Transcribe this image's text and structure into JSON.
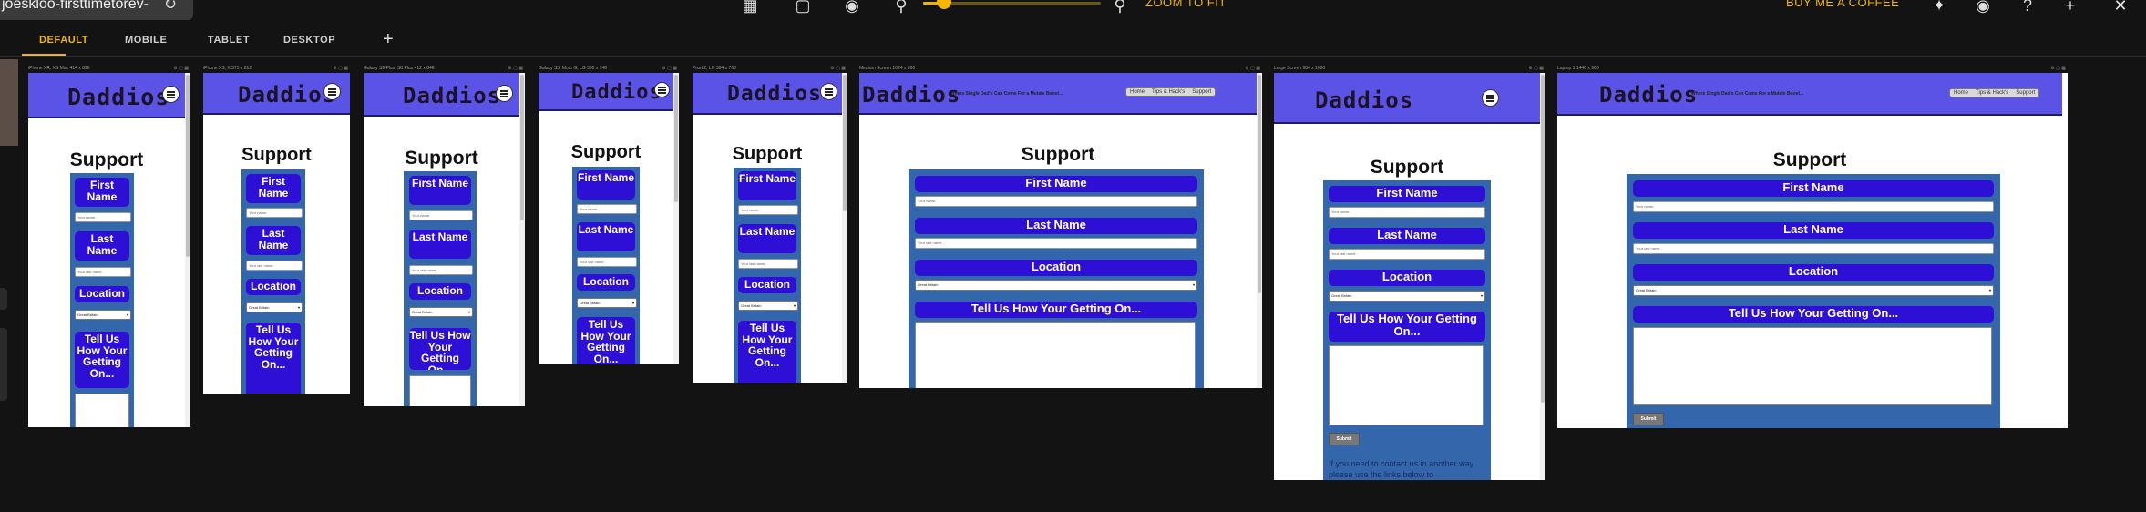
{
  "toolbar": {
    "url_text": "joeskloo-firsttimetorev-",
    "zoom_fit_label": "ZOOM TO FIT",
    "zoom_level_fraction": 0.12,
    "buy_coffee_label": "BUY ME A COFFEE",
    "icons": [
      "reload-icon",
      "grid-icon",
      "rotate-icon",
      "camera-icon",
      "zoom-out-icon",
      "zoom-in-icon",
      "twitter-icon",
      "github-icon",
      "help-icon",
      "plus-icon",
      "close-icon"
    ]
  },
  "tabs": [
    {
      "label": "DEFAULT",
      "active": true
    },
    {
      "label": "MOBILE",
      "active": false
    },
    {
      "label": "TABLET",
      "active": false
    },
    {
      "label": "DESKTOP",
      "active": false
    }
  ],
  "add_tab_label": "+",
  "site": {
    "logo": "Daddios",
    "tagline": "Where Single Dad's Can Come For a Mutale Boost...",
    "nav": [
      "Home",
      "Tips & Hack's",
      "Support"
    ],
    "page_title": "Support",
    "first_name_label": "First Name",
    "first_name_placeholder": "Your name..",
    "last_name_label": "Last Name",
    "last_name_placeholder": "Your last name..",
    "location_label": "Location",
    "location_value": "Great Britain",
    "message_label": "Tell Us How Your Getting On...",
    "submit_label": "Submit",
    "contact_note": "If you need to contact us in another way please use the links below to"
  },
  "devices": [
    {
      "name": "iPhone XR, XS Max",
      "size": "414 x 896"
    },
    {
      "name": "iPhone XS, X",
      "size": "375 x 812"
    },
    {
      "name": "Galaxy S9 Plus, S8 Plus",
      "size": "412 x 846"
    },
    {
      "name": "Galaxy S5, Moto G, LG",
      "size": "360 x 740"
    },
    {
      "name": "Pixel 2, LG",
      "size": "384 x 768"
    },
    {
      "name": "Medium Screen",
      "size": "1024 x 800"
    },
    {
      "name": "Large Screen",
      "size": "984 x 1000"
    },
    {
      "name": "Laptop 1",
      "size": "1440 x 900"
    }
  ],
  "colors": {
    "accent": "#f2b600",
    "header_bg": "#5b53e6",
    "label_bg": "#2d0fd6",
    "form_bg": "#3366aa"
  }
}
